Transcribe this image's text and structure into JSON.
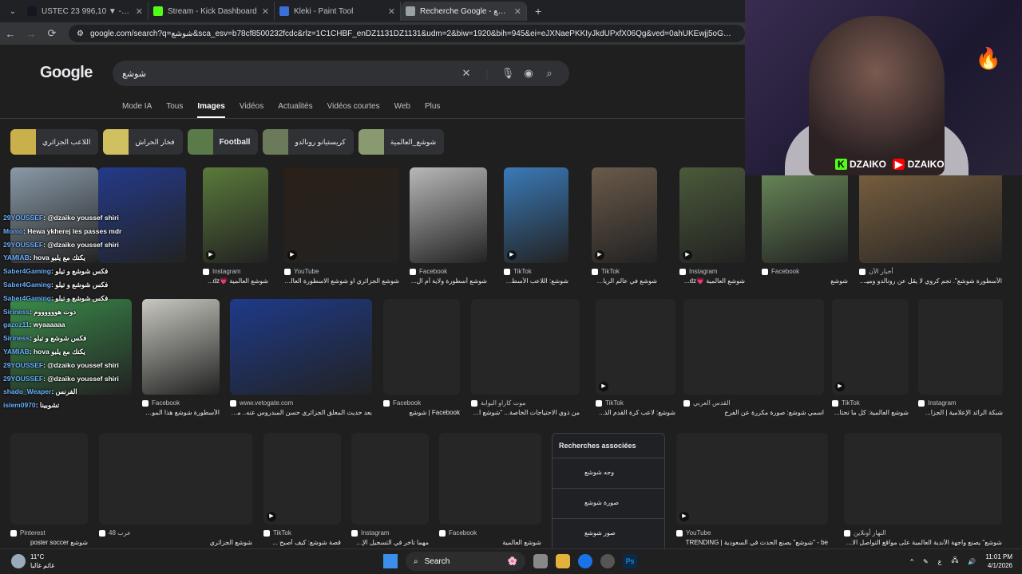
{
  "browser": {
    "tabs": [
      {
        "title": "USTEC 23 996,10 ▼ -0,04% Un",
        "favicon_color": "#131722",
        "active": false
      },
      {
        "title": "Stream - Kick Dashboard",
        "favicon_color": "#53fc18",
        "active": false
      },
      {
        "title": "Kleki - Paint Tool",
        "favicon_color": "#3b6fd8",
        "active": false
      },
      {
        "title": "Recherche Google - شوشع",
        "favicon_color": "#9aa0a6",
        "active": true
      }
    ],
    "url": "google.com/search?q=شوشع&sca_esv=b78cf8500232fcdc&rlz=1C1CHBF_enDZ1131DZ1131&udm=2&biw=1920&bih=945&ei=eJXNaePKKIyJkdUPxfX06Qg&ved=0ahUKEwjj5oGw082TAxWMRKQEHeU"
  },
  "google": {
    "logo": "Google",
    "query": "شوشع",
    "tabs": [
      "Mode IA",
      "Tous",
      "Images",
      "Vidéos",
      "Actualités",
      "Vidéos courtes",
      "Web",
      "Plus"
    ],
    "selected_tab": "Images",
    "chips": [
      {
        "label": "اللاعب الجزائري",
        "color": "#c9b04a"
      },
      {
        "label": "فخار الحراش",
        "color": "#d0c060"
      },
      {
        "label": "Football",
        "color": "#5a7a4a"
      },
      {
        "label": "كريستيانو رونالدو",
        "color": "#6a7a5a"
      },
      {
        "label": "شوشع_العالمية",
        "color": "#8a9a70"
      }
    ],
    "row1": [
      {
        "source": "",
        "caption": "",
        "color": "#8a9aa8",
        "video": false
      },
      {
        "source": "",
        "caption": "",
        "color": "#243a8a",
        "video": false
      },
      {
        "source": "Instagram",
        "caption": "شوشع العالمية 💗dz...",
        "color": "#5a7a3a",
        "video": true
      },
      {
        "source": "YouTube",
        "caption": "شوشع الجزائري او شوشع الاسطورة العالمية...",
        "color": "#2a2018",
        "video": true
      },
      {
        "source": "Facebook",
        "caption": "شوشع أسطورة ولاية أم ال...",
        "color": "#b8b8b8",
        "video": false
      },
      {
        "source": "TikTok",
        "caption": "شوشع: اللاعب الأسطورة ...",
        "color": "#3a7ab8",
        "video": true
      },
      {
        "source": "TikTok",
        "caption": "شوشع في عالم الرياضة: ك...",
        "color": "#6a5a4a",
        "video": true
      },
      {
        "source": "Instagram",
        "caption": "شوشع العالمية 💗dz...",
        "color": "#4a5a3a",
        "video": true
      },
      {
        "source": "Facebook",
        "caption": "شوشع",
        "color": "#6a8a5a",
        "video": false
      },
      {
        "source": "أخبار الآن",
        "caption": "الأسطورة شوشع\". نجم كروي لا يقل عن رونالدو وميـ...",
        "color": "#7a6040",
        "video": false
      }
    ],
    "row2": [
      {
        "source": "",
        "caption": "",
        "color": "#3a8a4a",
        "video": false
      },
      {
        "source": "Facebook",
        "caption": "الأسطورة شوشع هذا الموسـ...",
        "color": "#c8c8c0",
        "video": false
      },
      {
        "source": "www.vetogate.com",
        "caption": "بعد حديث المعلق الجزائري حسن المبدروس عنه.. من ...",
        "color": "#1e3a8a",
        "video": false
      },
      {
        "source": "Facebook",
        "caption": "Facebook | شوشع",
        "color": "",
        "video": false
      },
      {
        "source": "موت كاراو البوابة",
        "caption": "من ذوي الاحتياجات الخاصة... \"شوشع الع...",
        "color": "",
        "video": false
      },
      {
        "source": "TikTok",
        "caption": "شوشع: لاعب كرة القدم الذ...",
        "color": "",
        "video": true
      },
      {
        "source": "القدس العربي",
        "caption": "اسمي شوشع: صورة مكررة عن الفرح",
        "color": "",
        "video": false
      },
      {
        "source": "TikTok",
        "caption": "شوشع العالمية: كل ما تحتا...",
        "color": "",
        "video": true
      },
      {
        "source": "Instagram",
        "caption": "شبكة الرائد الإعلامية | الجزا...",
        "color": "",
        "video": false
      }
    ],
    "row3": [
      {
        "source": "Pinterest",
        "caption": "شوشع poster soccer",
        "video": false
      },
      {
        "source": "عرب 48",
        "caption": "شوشع الجزائري",
        "video": false
      },
      {
        "source": "TikTok",
        "caption": "قصة شوشع: كيف أصبح ...",
        "video": true
      },
      {
        "source": "Instagram",
        "caption": "مهما تأخر في التسجيل الإس...",
        "video": false
      },
      {
        "source": "Facebook",
        "caption": "شوشع العالمية",
        "video": false
      },
      {
        "source": "YouTube",
        "caption": "be - \"شوشع\" يصنع الحدث في السعودية | TRENDING",
        "video": true
      },
      {
        "source": "النهار أونلاين",
        "caption": "شوشع\" يصنع واجهة الأندية العالمية على مواقع التواصل الاج...",
        "video": false
      }
    ],
    "related": {
      "title": "Recherches associées",
      "items": [
        "وجه شوشع",
        "صورة شوشع",
        "صور شوشع"
      ]
    }
  },
  "stream": {
    "brand_kick": "DZAIKO",
    "brand_youtube": "DZAIKO",
    "chat": [
      {
        "name": "29YOUSSEF",
        "msg": ": @dzaiko youssef shiri"
      },
      {
        "name": "Momo",
        "msg": ": Hewa ykherej les passes mdr"
      },
      {
        "name": "29YOUSSEF",
        "msg": ": @dzaiko youssef shiri"
      },
      {
        "name": "YAMIAB",
        "msg": ": hova يكتك مع يلبو"
      },
      {
        "name": "Saber4Gaming",
        "msg": ": فكس شوشع و تيلو"
      },
      {
        "name": "Saber4Gaming",
        "msg": ": فكس شوشع و تيلو"
      },
      {
        "name": "Saber4Gaming",
        "msg": ": فكس شوشع و تيلو"
      },
      {
        "name": "Siriness",
        "msg": ": دوت هووووووم"
      },
      {
        "name": "gazoz11",
        "msg": ": wyaaaaaa"
      },
      {
        "name": "Siriness",
        "msg": ": فكس شوشع و تيلو"
      },
      {
        "name": "YAMIAB",
        "msg": ": hova يكتك مع يلبو"
      },
      {
        "name": "29YOUSSEF",
        "msg": ": @dzaiko youssef shiri"
      },
      {
        "name": "29YOUSSEF",
        "msg": ": @dzaiko youssef shiri"
      },
      {
        "name": "shado_Weaper",
        "msg": ": الفرنس"
      },
      {
        "name": "islem0970",
        "msg": ": تشوبينا"
      }
    ]
  },
  "taskbar": {
    "temp": "11°C",
    "weather": "غائم غالبا",
    "search": "Search",
    "time": "11:01 PM",
    "date": "4/1/2026",
    "lang": "ع"
  }
}
